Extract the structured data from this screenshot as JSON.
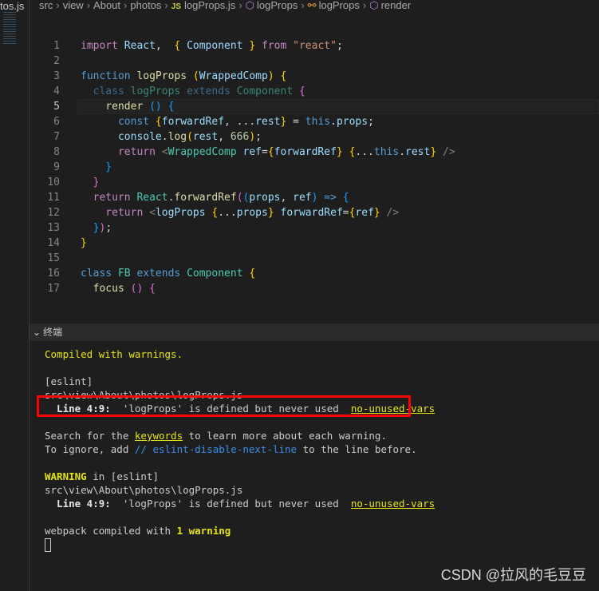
{
  "left_tab": {
    "label": "tos.js"
  },
  "breadcrumb": [
    "src",
    "view",
    "About",
    "photos",
    "logProps.js",
    "logProps",
    "logProps",
    "render"
  ],
  "editor": {
    "current_line": 5,
    "lines": [
      {
        "n": 1,
        "t": [
          [
            "import",
            "k"
          ],
          [
            " React",
            "v"
          ],
          [
            ",  ",
            "p"
          ],
          [
            "{",
            "b1"
          ],
          [
            " Component ",
            "v"
          ],
          [
            "}",
            "b1"
          ],
          [
            " from",
            "k"
          ],
          [
            " ",
            "p"
          ],
          [
            "\"react\"",
            "str"
          ],
          [
            ";",
            "p"
          ]
        ]
      },
      {
        "n": 2,
        "t": []
      },
      {
        "n": 3,
        "t": [
          [
            "function",
            "s"
          ],
          [
            " logProps",
            "f"
          ],
          [
            " ",
            "p"
          ],
          [
            "(",
            "b1"
          ],
          [
            "WrappedComp",
            "v"
          ],
          [
            ")",
            "b1"
          ],
          [
            " ",
            "p"
          ],
          [
            "{",
            "b1"
          ]
        ]
      },
      {
        "n": 4,
        "t": [
          [
            "  ",
            "p"
          ],
          [
            "class",
            "s dim"
          ],
          [
            " logProps",
            "c dim"
          ],
          [
            " extends",
            "s dim"
          ],
          [
            " Component",
            "c dim"
          ],
          [
            " ",
            "p"
          ],
          [
            "{",
            "b2"
          ]
        ]
      },
      {
        "n": 5,
        "t": [
          [
            "    render",
            "f"
          ],
          [
            " ",
            "p"
          ],
          [
            "()",
            "b3"
          ],
          [
            " ",
            "p"
          ],
          [
            "{",
            "b3"
          ]
        ]
      },
      {
        "n": 6,
        "t": [
          [
            "      const",
            "s"
          ],
          [
            " ",
            "p"
          ],
          [
            "{",
            "b1"
          ],
          [
            "forwardRef",
            "v"
          ],
          [
            ", ...",
            "p"
          ],
          [
            "rest",
            "v"
          ],
          [
            "}",
            "b1"
          ],
          [
            " = ",
            "p"
          ],
          [
            "this",
            "s"
          ],
          [
            ".",
            "p"
          ],
          [
            "props",
            "v"
          ],
          [
            ";",
            "p"
          ]
        ]
      },
      {
        "n": 7,
        "t": [
          [
            "      console",
            "v"
          ],
          [
            ".",
            "p"
          ],
          [
            "log",
            "f"
          ],
          [
            "(",
            "b1"
          ],
          [
            "rest",
            "v"
          ],
          [
            ", ",
            "p"
          ],
          [
            "666",
            "n"
          ],
          [
            ")",
            "b1"
          ],
          [
            ";",
            "p"
          ]
        ]
      },
      {
        "n": 8,
        "t": [
          [
            "      return",
            "k"
          ],
          [
            " <",
            "t"
          ],
          [
            "WrappedComp",
            "c"
          ],
          [
            " ref",
            "v"
          ],
          [
            "=",
            "p"
          ],
          [
            "{",
            "b1"
          ],
          [
            "forwardRef",
            "v"
          ],
          [
            "}",
            "b1"
          ],
          [
            " ",
            "p"
          ],
          [
            "{",
            "b1"
          ],
          [
            "...",
            "p"
          ],
          [
            "this",
            "s"
          ],
          [
            ".",
            "p"
          ],
          [
            "rest",
            "v"
          ],
          [
            "}",
            "b1"
          ],
          [
            " />",
            "t"
          ]
        ]
      },
      {
        "n": 9,
        "t": [
          [
            "    }",
            "b3"
          ]
        ]
      },
      {
        "n": 10,
        "t": [
          [
            "  }",
            "b2"
          ]
        ]
      },
      {
        "n": 11,
        "t": [
          [
            "  return",
            "k"
          ],
          [
            " React",
            "c"
          ],
          [
            ".",
            "p"
          ],
          [
            "forwardRef",
            "f"
          ],
          [
            "(",
            "b2"
          ],
          [
            "(",
            "b3"
          ],
          [
            "props",
            "v"
          ],
          [
            ", ",
            "p"
          ],
          [
            "ref",
            "v"
          ],
          [
            ")",
            "b3"
          ],
          [
            " =>",
            "s"
          ],
          [
            " ",
            "p"
          ],
          [
            "{",
            "b3"
          ]
        ]
      },
      {
        "n": 12,
        "t": [
          [
            "    return",
            "k"
          ],
          [
            " <",
            "t"
          ],
          [
            "logProps",
            "v"
          ],
          [
            " ",
            "p"
          ],
          [
            "{",
            "b1"
          ],
          [
            "...",
            "p"
          ],
          [
            "props",
            "v"
          ],
          [
            "}",
            "b1"
          ],
          [
            " forwardRef",
            "v"
          ],
          [
            "=",
            "p"
          ],
          [
            "{",
            "b1"
          ],
          [
            "ref",
            "v"
          ],
          [
            "}",
            "b1"
          ],
          [
            " />",
            "t"
          ]
        ]
      },
      {
        "n": 13,
        "t": [
          [
            "  }",
            "b3"
          ],
          [
            ")",
            "b2"
          ],
          [
            ";",
            "p"
          ]
        ]
      },
      {
        "n": 14,
        "t": [
          [
            "}",
            "b1"
          ]
        ]
      },
      {
        "n": 15,
        "t": []
      },
      {
        "n": 16,
        "t": [
          [
            "class",
            "s"
          ],
          [
            " FB",
            "c"
          ],
          [
            " extends",
            "s"
          ],
          [
            " Component",
            "c"
          ],
          [
            " ",
            "p"
          ],
          [
            "{",
            "b1"
          ]
        ]
      },
      {
        "n": 17,
        "t": [
          [
            "  focus",
            "f"
          ],
          [
            " ",
            "p"
          ],
          [
            "()",
            "b2"
          ],
          [
            " ",
            "p"
          ],
          [
            "{",
            "b2"
          ]
        ]
      }
    ]
  },
  "terminal": {
    "title": "终端",
    "lines": [
      [
        [
          "Compiled with warnings.",
          "y"
        ]
      ],
      [],
      [
        [
          "[eslint]",
          ""
        ]
      ],
      [
        [
          "src\\view\\About\\photos\\logProps.js",
          ""
        ]
      ],
      [
        [
          "  Line 4:9:",
          "bw"
        ],
        [
          "  'logProps' is defined but never used  ",
          ""
        ],
        [
          "no-unused-vars",
          "y u"
        ]
      ],
      [],
      [
        [
          "Search for the ",
          ""
        ],
        [
          "keywords",
          "y u"
        ],
        [
          " to learn more about each warning.",
          ""
        ]
      ],
      [
        [
          "To ignore, add ",
          ""
        ],
        [
          "// eslint-disable-next-line",
          "bl"
        ],
        [
          " to the line before.",
          ""
        ]
      ],
      [],
      [
        [
          "WARNING",
          "by"
        ],
        [
          " in [eslint]",
          ""
        ]
      ],
      [
        [
          "src\\view\\About\\photos\\logProps.js",
          ""
        ]
      ],
      [
        [
          "  Line 4:9:",
          "bw"
        ],
        [
          "  'logProps' is defined but never used  ",
          ""
        ],
        [
          "no-unused-vars",
          "y u"
        ]
      ],
      [],
      [
        [
          "webpack compiled with ",
          ""
        ],
        [
          "1 warning",
          "by"
        ]
      ]
    ]
  },
  "watermark": "CSDN @拉风的毛豆豆"
}
